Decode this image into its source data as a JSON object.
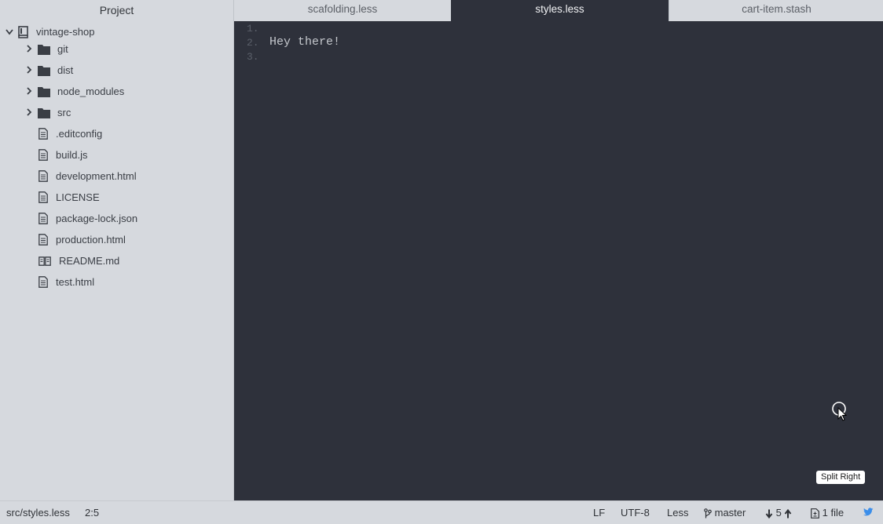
{
  "sidebar": {
    "title": "Project",
    "root": "vintage-shop",
    "folders": [
      {
        "label": "git",
        "icon": "folder-icon"
      },
      {
        "label": "dist",
        "icon": "folder-icon"
      },
      {
        "label": "node_modules",
        "icon": "folder-icon"
      },
      {
        "label": "src",
        "icon": "folder-icon"
      }
    ],
    "files": [
      {
        "label": ".editconfig",
        "icon": "file-icon"
      },
      {
        "label": "build.js",
        "icon": "file-icon"
      },
      {
        "label": "development.html",
        "icon": "file-icon"
      },
      {
        "label": "LICENSE",
        "icon": "file-icon"
      },
      {
        "label": "package-lock.json",
        "icon": "file-icon"
      },
      {
        "label": "production.html",
        "icon": "file-icon"
      },
      {
        "label": "README.md",
        "icon": "book-icon"
      },
      {
        "label": "test.html",
        "icon": "file-icon"
      }
    ]
  },
  "tabs": [
    {
      "label": "scafolding.less",
      "active": false
    },
    {
      "label": "styles.less",
      "active": true
    },
    {
      "label": "cart-item.stash",
      "active": false
    }
  ],
  "editor": {
    "lines": [
      {
        "num": "1.",
        "text": ""
      },
      {
        "num": "2.",
        "text": "Hey there!"
      },
      {
        "num": "3.",
        "text": ""
      }
    ]
  },
  "tooltip": "Split Right",
  "status": {
    "path": "src/styles.less",
    "cursor_pos": "2:5",
    "line_ending": "LF",
    "encoding": "UTF-8",
    "grammar": "Less",
    "branch": "master",
    "sync_count": "5",
    "changed_files": "1 file"
  },
  "colors": {
    "sidebar_bg": "#d6d9de",
    "editor_bg": "#2e313b",
    "accent_blue": "#3b8eea"
  }
}
